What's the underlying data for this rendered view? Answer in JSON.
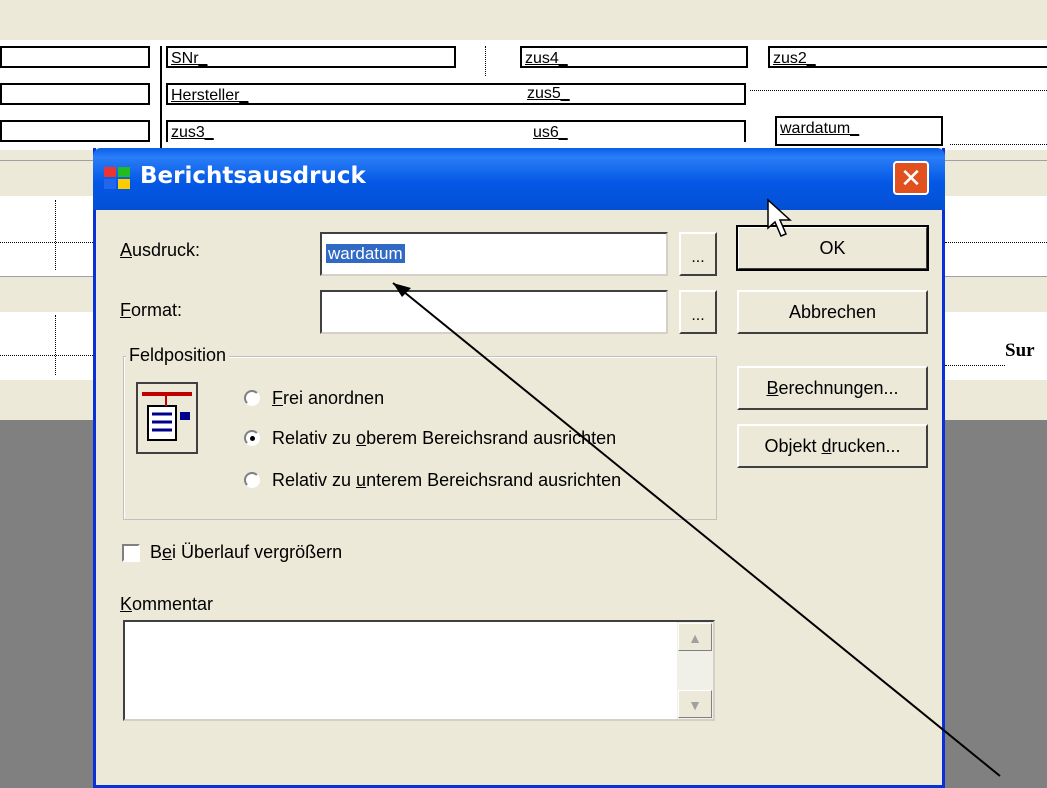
{
  "designer": {
    "fields": [
      {
        "label": "SNr_",
        "id": "snr"
      },
      {
        "label": "zus4_",
        "id": "zus4"
      },
      {
        "label": "zus2_",
        "id": "zus2"
      },
      {
        "label": "Hersteller_",
        "id": "hersteller"
      },
      {
        "label": "zus5_",
        "id": "zus5"
      },
      {
        "label": "zus3_",
        "id": "zus3"
      },
      {
        "label": "us6_",
        "id": "zus6"
      },
      {
        "label": "wardatum_",
        "id": "wardatum"
      }
    ],
    "side_text": "Sur"
  },
  "dialog": {
    "title": "Berichtsausdruck",
    "close_glyph": "✕",
    "ausdruck": {
      "label_u": "A",
      "label_rest": "usdruck:",
      "value": "wardatum",
      "browse": "..."
    },
    "format": {
      "label_u": "F",
      "label_rest": "ormat:",
      "value": "",
      "browse": "..."
    },
    "buttons": {
      "ok": "OK",
      "cancel": "Abbrechen",
      "calc_u": "B",
      "calc_rest": "erechnungen...",
      "print_pre": "Objekt ",
      "print_u": "d",
      "print_rest": "rucken..."
    },
    "feldposition": {
      "legend": "Feldposition",
      "options": [
        {
          "pre": "",
          "u": "F",
          "rest": "rei anordnen",
          "checked": false
        },
        {
          "pre": "Relativ zu ",
          "u": "o",
          "rest": "berem Bereichsrand ausrichten",
          "checked": true
        },
        {
          "pre": "Relativ zu ",
          "u": "u",
          "rest": "nterem Bereichsrand ausrichten",
          "checked": false
        }
      ]
    },
    "overflow": {
      "pre": "B",
      "u": "e",
      "rest": "i Überlauf vergrößern",
      "checked": false
    },
    "kommentar": {
      "label_u": "K",
      "label_rest": "ommentar",
      "value": ""
    },
    "scroll_up": "▲",
    "scroll_down": "▼"
  }
}
